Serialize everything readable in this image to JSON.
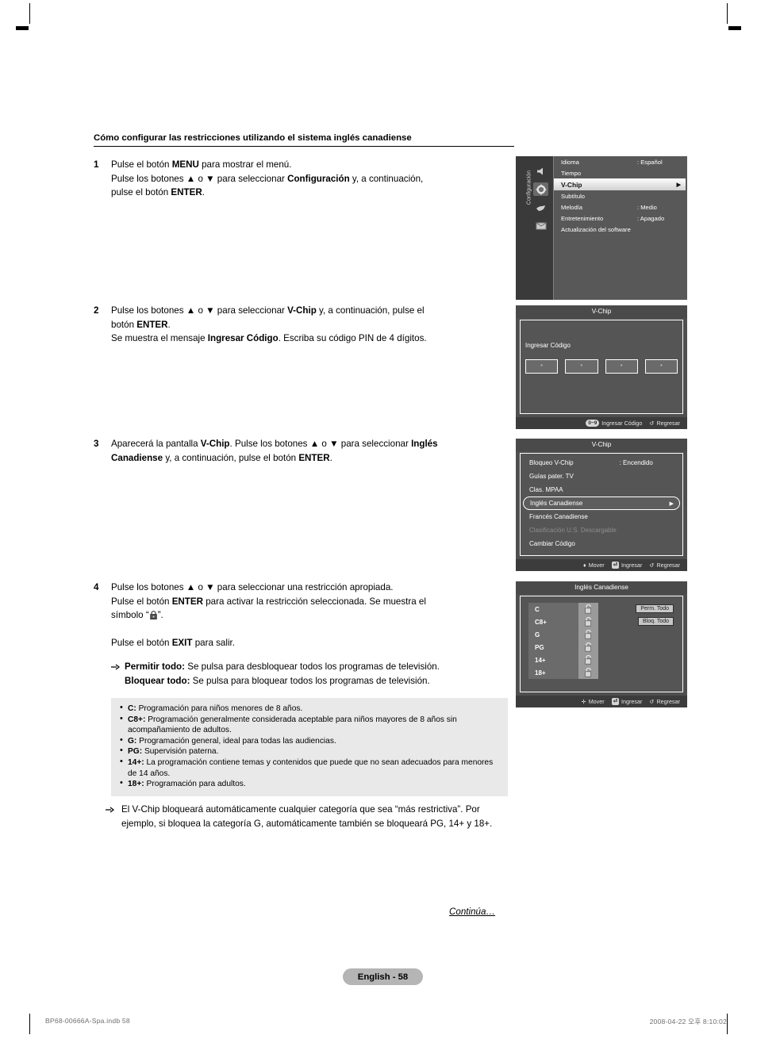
{
  "heading": "Cómo configurar las restricciones utilizando el sistema inglés canadiense",
  "steps": {
    "s1": {
      "num": "1",
      "line1_a": "Pulse el botón ",
      "line1_b": "MENU",
      "line1_c": " para mostrar el menú.",
      "line2_a": "Pulse los botones ▲ o ▼ para seleccionar ",
      "line2_b": "Configuración",
      "line2_c": " y, a continuación,",
      "line3_a": "pulse el botón ",
      "line3_b": "ENTER",
      "line3_c": "."
    },
    "s2": {
      "num": "2",
      "line1_a": "Pulse los botones ▲ o ▼ para seleccionar ",
      "line1_b": "V-Chip",
      "line1_c": " y, a continuación, pulse el",
      "line2_a": "botón ",
      "line2_b": "ENTER",
      "line2_c": ".",
      "line3_a": "Se muestra el mensaje ",
      "line3_b": "Ingresar Código",
      "line3_c": ". Escriba su código PIN de 4 dígitos."
    },
    "s3": {
      "num": "3",
      "line1_a": "Aparecerá la pantalla ",
      "line1_b": "V-Chip",
      "line1_c": ". Pulse los botones ▲ o ▼ para seleccionar ",
      "line1_d": "Inglés",
      "line2_a": "Canadiense",
      "line2_b": " y, a continuación, pulse el botón ",
      "line2_c": "ENTER",
      "line2_d": "."
    },
    "s4": {
      "num": "4",
      "line1": "Pulse los botones ▲ o ▼ para seleccionar una restricción apropiada.",
      "line2_a": "Pulse el botón ",
      "line2_b": "ENTER",
      "line2_c": " para activar la restricción seleccionada. Se muestra el",
      "line3_a": "símbolo “",
      "line3_b": "”.",
      "line4_a": "Pulse el botón ",
      "line4_b": "EXIT",
      "line4_c": " para salir.",
      "bullet1_b": "Permitir todo:",
      "bullet1_t": " Se pulsa para desbloquear todos los programas de televisión.",
      "bullet2_b": "Bloquear todo:",
      "bullet2_t": " Se pulsa para bloquear todos los programas de televisión."
    }
  },
  "definitions": [
    {
      "term": "C:",
      "text": " Programación para niños menores de 8 años."
    },
    {
      "term": "C8+:",
      "text": " Programación generalmente considerada aceptable para niños mayores de 8 años sin acompañamiento de adultos."
    },
    {
      "term": "G:",
      "text": " Programación general, ideal para todas las audiencias."
    },
    {
      "term": "PG:",
      "text": " Supervisión paterna."
    },
    {
      "term": "14+:",
      "text": " La programación contiene temas y contenidos que puede que no sean adecuados para menores de 14 años."
    },
    {
      "term": "18+:",
      "text": " Programación para adultos."
    }
  ],
  "note": "El V-Chip bloqueará automáticamente cualquier categoría que sea “más restrictiva”. Por ejemplo, si bloquea la categoría G, automáticamente también se bloqueará PG, 14+ y 18+.",
  "continua": "Continúa…",
  "page_badge": "English - 58",
  "footer": {
    "left": "BP68-00666A-Spa.indb   58",
    "right": "2008-04-22   오후 8:10:02"
  },
  "osd1": {
    "sidebar_label": "Configuración",
    "icons": [
      "speaker-icon",
      "gear-icon",
      "hand-icon",
      "envelope-icon"
    ],
    "rows": [
      {
        "label": "Idioma",
        "value": ": Español"
      },
      {
        "label": "Tiempo",
        "value": ""
      },
      {
        "label": "V-Chip",
        "value": "",
        "arrow": "▶"
      },
      {
        "label": "Subtítulo",
        "value": ""
      },
      {
        "label": "Melodía",
        "value": ": Medio"
      },
      {
        "label": "Entretenimiento",
        "value": ": Apagado"
      },
      {
        "label": "Actualización del software",
        "value": ""
      }
    ]
  },
  "osd2": {
    "title": "V-Chip",
    "label": "Ingresar Código",
    "digits": [
      "*",
      "*",
      "*",
      "*"
    ],
    "foot": [
      {
        "key": "0~9",
        "text": "Ingresar Código"
      },
      {
        "key": "↺",
        "text": "Regresar"
      }
    ]
  },
  "osd3": {
    "title": "V-Chip",
    "rows": [
      {
        "label": "Bloqueo V-Chip",
        "value": ": Encendido"
      },
      {
        "label": "Guías pater. TV",
        "value": ""
      },
      {
        "label": "Clas. MPAA",
        "value": ""
      },
      {
        "label": "Inglés Canadiense",
        "value": "",
        "arrow": "▶"
      },
      {
        "label": "Francés Canadiense",
        "value": ""
      },
      {
        "label": "Clasificación U.S. Descargable",
        "value": ""
      },
      {
        "label": "Cambiar Código",
        "value": ""
      }
    ],
    "foot": [
      {
        "key": "♦",
        "text": "Mover"
      },
      {
        "key": "⏎",
        "text": "Ingresar"
      },
      {
        "key": "↺",
        "text": "Regresar"
      }
    ]
  },
  "osd4": {
    "title": "Inglés Canadiense",
    "ratings": [
      "C",
      "C8+",
      "G",
      "PG",
      "14+",
      "18+"
    ],
    "buttons": [
      "Perm. Todo",
      "Bloq. Todo"
    ],
    "foot": [
      {
        "key": "✛",
        "text": "Mover"
      },
      {
        "key": "⏎",
        "text": "Ingresar"
      },
      {
        "key": "↺",
        "text": "Regresar"
      }
    ]
  }
}
